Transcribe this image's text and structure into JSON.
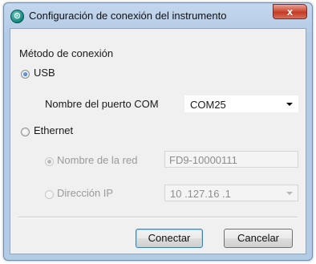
{
  "window": {
    "title": "Configuración de conexión del instrumento",
    "app_icon_glyph": "⊙",
    "close_glyph": "x"
  },
  "connection_method": {
    "heading": "Método de conexión",
    "usb": {
      "label": "USB",
      "selected": true,
      "com_port_label": "Nombre del puerto COM",
      "com_port_value": "COM25"
    },
    "ethernet": {
      "label": "Ethernet",
      "selected": false,
      "network_name_label": "Nombre de la red",
      "network_name_value": "FD9-10000111",
      "network_name_selected": true,
      "ip_label": "Dirección IP",
      "ip_value": "10 .127.16 .1"
    }
  },
  "buttons": {
    "connect": "Conectar",
    "cancel": "Cancelar"
  },
  "colors": {
    "titlebar": "#b4cbe6",
    "close_button": "#c23a25",
    "dialog_bg": "#f0f0f0",
    "radio_selected": "#1f5fa8"
  }
}
